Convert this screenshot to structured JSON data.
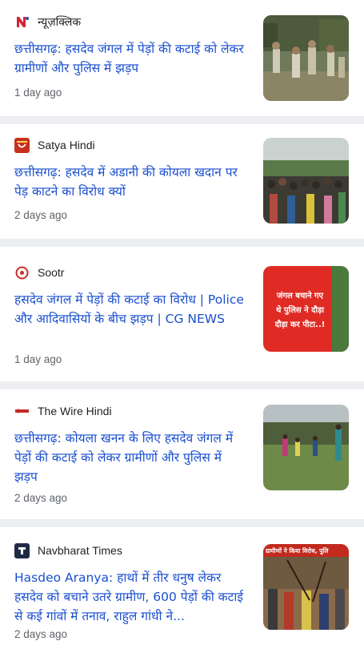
{
  "articles": [
    {
      "source": "न्यूज़क्लिक",
      "logo": "newsclick-logo-icon",
      "headline": "छत्तीसगढ़: हसदेव जंगल में पेड़ों की कटाई को लेकर ग्रामीणों और पुलिस में झड़प",
      "time": "1 day ago",
      "thumb": "police-in-forest-image"
    },
    {
      "source": "Satya Hindi",
      "logo": "satya-hindi-logo-icon",
      "headline": "छत्तीसगढ़: हसदेव में अडानी की कोयला खदान पर पेड़ काटने का विरोध क्यों",
      "time": "2 days ago",
      "thumb": "crowd-protest-image"
    },
    {
      "source": "Sootr",
      "logo": "sootr-logo-icon",
      "headline": "हसदेव जंगल में पेड़ों की कटाई का विरोध | Police और आदिवासियों के बीच झड़प | CG NEWS",
      "time": "1 day ago",
      "thumb": "red-banner-video-thumbnail",
      "thumb_text": [
        "जंगल बचाने गए",
        "थे पुलिस ने दौड़ा",
        "दौड़ा कर पीटा..!"
      ]
    },
    {
      "source": "The Wire Hindi",
      "logo": "the-wire-logo-icon",
      "headline": "छत्तीसगढ़: कोयला खनन के लिए हसदेव जंगल में पेड़ों की कटाई को लेकर ग्रामीणों और पुलिस में झड़प",
      "time": "2 days ago",
      "thumb": "villagers-in-field-image"
    },
    {
      "source": "Navbharat Times",
      "logo": "navbharat-times-logo-icon",
      "headline": "Hasdeo Aranya: हाथों में तीर धनुष लेकर हसदेव को बचाने उतरे ग्रामीण, 600 पेड़ों की कटाई से कई गांवों में तनाव, राहुल गांधी ने...",
      "time": "2 days ago",
      "thumb": "protest-video-thumbnail",
      "thumb_text": "ग्रामीणों ने किया विरोध, पुलि"
    }
  ],
  "colors": {
    "headline": "#1a4fd0",
    "meta": "#5f6368",
    "background": "#eceef1"
  }
}
